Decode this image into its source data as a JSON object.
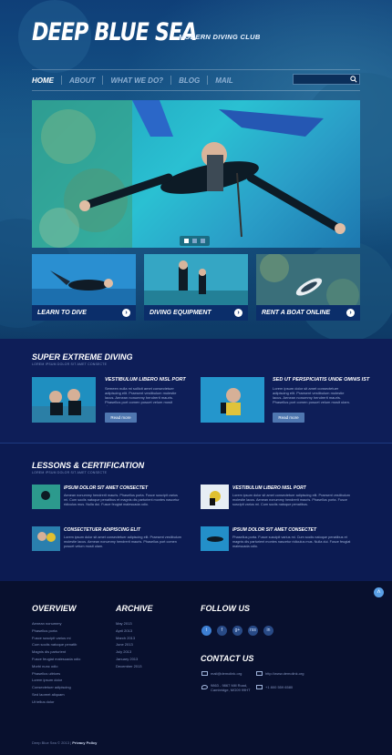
{
  "header": {
    "logo": "DEEP BLUE SEA",
    "tagline": "MODERN DIVING CLUB",
    "nav": [
      "HOME",
      "ABOUT",
      "WHAT WE DO?",
      "BLOG",
      "MAIL"
    ],
    "search_placeholder": ""
  },
  "slider": {
    "dots": 3,
    "active_dot": 0
  },
  "cards": [
    {
      "label": "LEARN TO DIVE"
    },
    {
      "label": "DIVING EQUIPMENT"
    },
    {
      "label": "RENT A BOAT ONLINE"
    }
  ],
  "super_extreme": {
    "title": "SUPER EXTREME DIVING",
    "subtitle": "LOREM IPSUM DOLOR SIT AMET CONSECTE",
    "items": [
      {
        "title": "VESTIBULUM LIBERO NISL PORT",
        "text": "Semeen nulla mi sollicit amet consectetuer adipiscing elit. Praesent vestibulum molestie lacus. Aenean nonummy hendrerit mauris. Phasellus port comen posuet velum mosit ulam.",
        "button": "Read more"
      },
      {
        "title": "SED UT PERSPICIATIS UNDE OMNIS IST",
        "text": "Lorem ipsum dolor sit amet consectetuer adipiscing elit. Praesent vestibulum molestie lacus. Aenean nonummy hendrerit mauris. Phasellus port comen posuet velum mosit ulam.",
        "button": "Read more"
      }
    ]
  },
  "lessons": {
    "title": "LESSONS & CERTIFICATION",
    "subtitle": "LOREM IPSUM DOLOR SIT AMET CONSECTE",
    "items": [
      {
        "title": "IPSUM DOLOR SIT AMET CONSECTET",
        "text": "Aenean nonummy hendrerit mauris. Phasellus porta. Fusce suscipit varius mi. Cum sociis natoque penatibus et magnis dis parturient montes nascetur ridiculus mus. Nulla dui. Fusce feugiat malesuada odio."
      },
      {
        "title": "VESTIBULUM LIBERO NISL PORT",
        "text": "Lorem ipsum dolor sit amet consectetuer adipiscing elit. Praesent vestibulum molestie lacus. Aenean nonummy hendrerit mauris. Phasellus porta. Fusce suscipit varius mi. Cum sociis natoque penatibus."
      },
      {
        "title": "CONSECTETUER ADIPISCING ELIT",
        "text": "Lorem ipsum dolor sit amet consectetuer adipiscing elit. Praesent vestibulum molestie lacus. Aenean nonummy hendrerit mauris. Phasellus port comen posuet velum mosit ulam."
      },
      {
        "title": "IPSUM DOLOR SIT AMET CONSECTET",
        "text": "Phasellus porta. Fusce suscipit varius mi. Cum sociis natoque penatibus et magnis dis parturient montes nascetur ridiculus mus. Nulla dui. Fusce feugiat malesuada odio."
      }
    ]
  },
  "footer": {
    "overview_title": "OVERVIEW",
    "overview_links": [
      "Aenean nonummy",
      "Phasellus porta",
      "Fusce suscipit varius mi",
      "Cum sociis natoque penatib",
      "Magnis dis parturient",
      "Fusce feugiat malesuada odio",
      "Morbi nunc odio",
      "Phasellus ultrices",
      "Lorem ipsum dolor",
      "Consectetuer adipiscing",
      "Sed laoreet aliquam",
      "Ut tellus dolor"
    ],
    "archive_title": "ARCHIVE",
    "archive_links": [
      "May 2013",
      "April 2013",
      "March 2013",
      "June 2013",
      "July 2013",
      "January 2013",
      "December 2013"
    ],
    "follow_title": "FOLLOW US",
    "social": [
      "t",
      "f",
      "g+",
      "rss",
      "in"
    ],
    "contact_title": "CONTACT US",
    "email": "mail@demolink.org",
    "website": "http://www.demolink.org",
    "address": "9863 - 9867 Mill Road, Cambridge, MG09 99HT",
    "phone": "+1 800 559 6580",
    "copyright": "Deep Blue Sea © 2013 |",
    "privacy": "Privacy Policy"
  },
  "colors": {
    "accent": "#4f77b0",
    "dark_bg": "#0e1e58",
    "footer_bg": "#08102e"
  }
}
